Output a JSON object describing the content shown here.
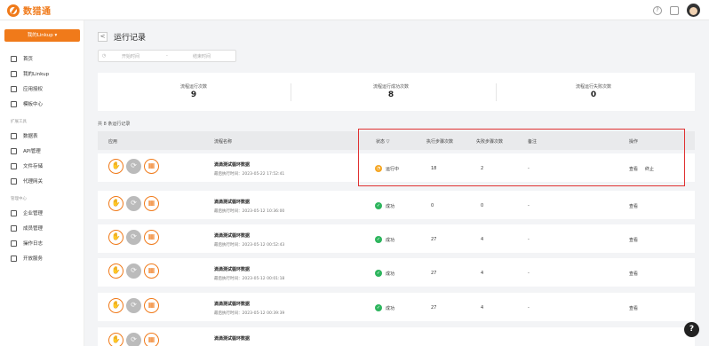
{
  "app": {
    "brand": "数猎通",
    "accent": "#f07a1a"
  },
  "sidebar": {
    "cta": "我的Linkup ▾",
    "items": [
      {
        "label": "首页",
        "icon": "home-icon"
      },
      {
        "label": "我的Linkup",
        "icon": "stack-icon"
      },
      {
        "label": "应用授权",
        "icon": "cube-icon"
      },
      {
        "label": "模板中心",
        "icon": "grid-icon"
      }
    ],
    "section_tools": "扩展工具",
    "tools": [
      {
        "label": "数据表",
        "icon": "table-icon"
      },
      {
        "label": "API管理",
        "icon": "api-icon"
      },
      {
        "label": "文件存储",
        "icon": "folder-icon"
      },
      {
        "label": "代理网关",
        "icon": "gateway-icon"
      }
    ],
    "section_admin": "管理中心",
    "admin": [
      {
        "label": "企业管理",
        "icon": "company-icon"
      },
      {
        "label": "成员管理",
        "icon": "members-icon"
      },
      {
        "label": "操作日志",
        "icon": "log-icon"
      },
      {
        "label": "开放服务",
        "icon": "service-icon"
      }
    ]
  },
  "page": {
    "title": "运行记录",
    "back": "<"
  },
  "filter": {
    "start_placeholder": "开始时间",
    "sep": "-",
    "end_placeholder": "结束时间"
  },
  "stats": [
    {
      "label": "流程运行次数",
      "value": "9"
    },
    {
      "label": "流程运行成功次数",
      "value": "8"
    },
    {
      "label": "流程运行失败次数",
      "value": "0"
    }
  ],
  "count_text": "共 8 条运行记录",
  "columns": [
    "应用",
    "流程名称",
    "状态 ▽",
    "执行步骤次数",
    "失败步骤次数",
    "备注",
    "操作"
  ],
  "rows": [
    {
      "name": "滴滴测试循环数据",
      "time": "最后执行时间：2023-05-22 17:52:41",
      "status": "运行中",
      "status_type": "run",
      "steps": "18",
      "fails": "2",
      "note": "-",
      "actions": [
        "查看",
        "终止"
      ]
    },
    {
      "name": "滴滴测试循环数据",
      "time": "最后执行时间：2023-05-12 10:36:00",
      "status": "成功",
      "status_type": "ok",
      "steps": "0",
      "fails": "0",
      "note": "-",
      "actions": [
        "查看"
      ]
    },
    {
      "name": "滴滴测试循环数据",
      "time": "最后执行时间：2023-05-12 00:52:43",
      "status": "成功",
      "status_type": "ok",
      "steps": "27",
      "fails": "4",
      "note": "-",
      "actions": [
        "查看"
      ]
    },
    {
      "name": "滴滴测试循环数据",
      "time": "最后执行时间：2023-05-12 00:01:18",
      "status": "成功",
      "status_type": "ok",
      "steps": "27",
      "fails": "4",
      "note": "-",
      "actions": [
        "查看"
      ]
    },
    {
      "name": "滴滴测试循环数据",
      "time": "最后执行时间：2023-05-12 00:39:39",
      "status": "成功",
      "status_type": "ok",
      "steps": "27",
      "fails": "4",
      "note": "-",
      "actions": [
        "查看"
      ]
    },
    {
      "name": "滴滴测试循环数据",
      "time": "",
      "status": "",
      "status_type": "",
      "steps": "",
      "fails": "",
      "note": "",
      "actions": []
    }
  ],
  "help": "?"
}
